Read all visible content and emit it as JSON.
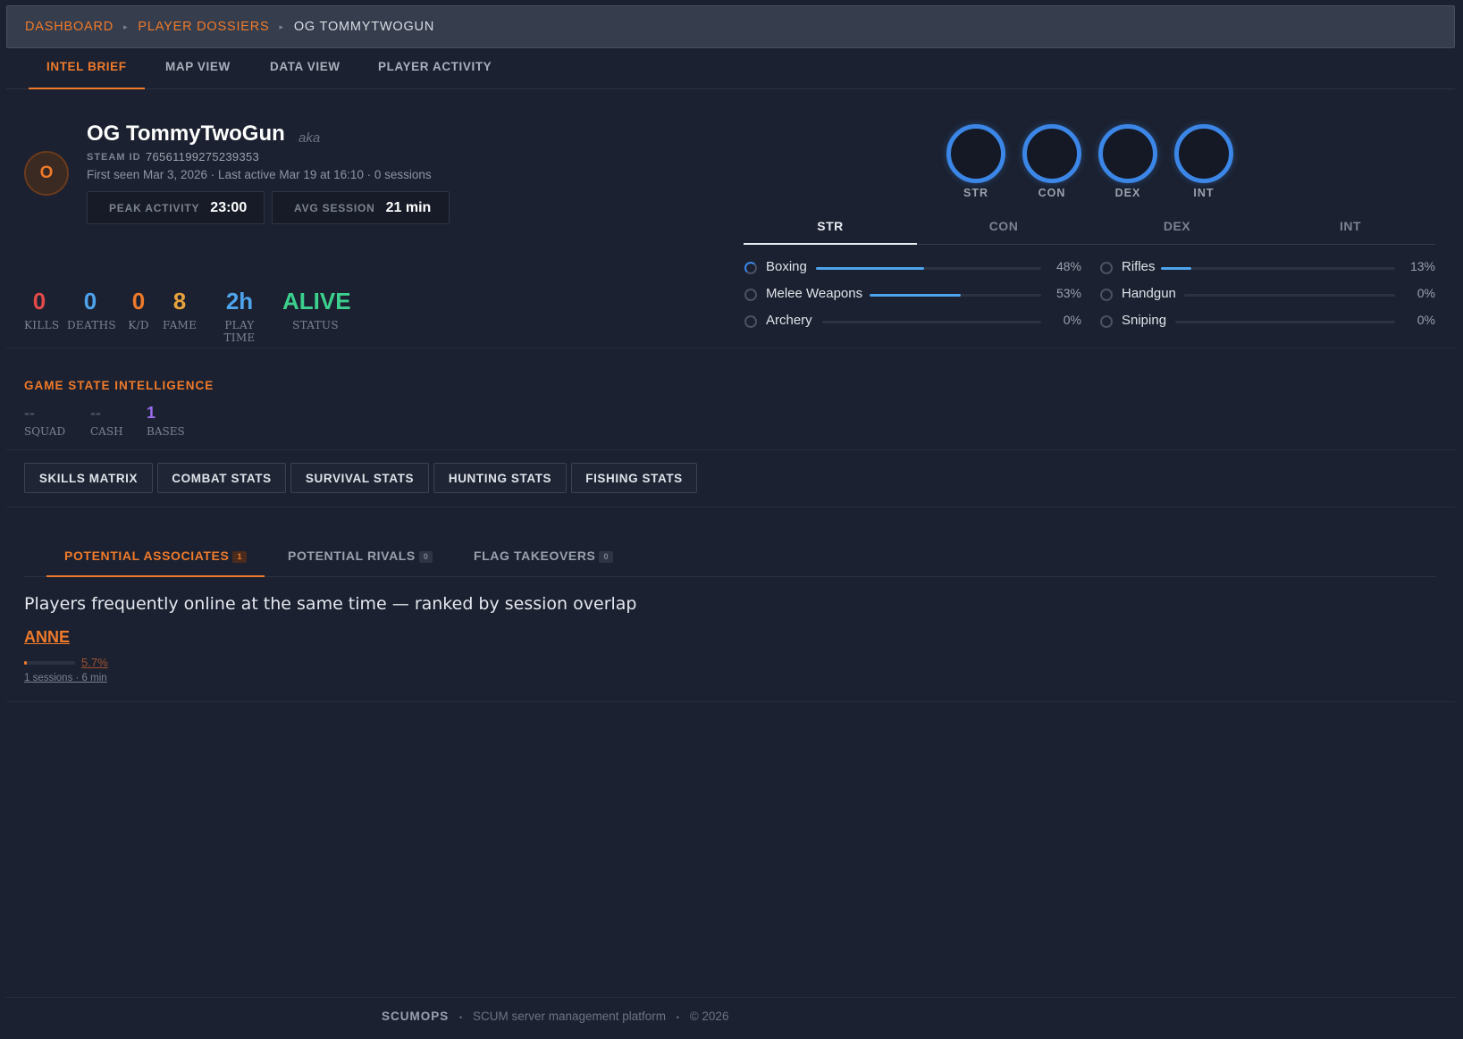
{
  "breadcrumb": {
    "items": [
      "DASHBOARD",
      "PLAYER DOSSIERS"
    ],
    "current": "OG TOMMYTWOGUN",
    "separator": "▸"
  },
  "tabs": [
    "INTEL BRIEF",
    "MAP VIEW",
    "DATA VIEW",
    "PLAYER ACTIVITY"
  ],
  "active_tab": "INTEL BRIEF",
  "player": {
    "avatar_letter": "O",
    "name": "OG TommyTwoGun",
    "aka": "aka",
    "steam_label": "STEAM ID",
    "steam_id": "76561199275239353",
    "seen": "First seen Mar 3, 2026 · Last active Mar 19 at 16:10 · 0 sessions",
    "peak_label": "PEAK ACTIVITY",
    "peak_value": "23:00",
    "avg_label": "AVG SESSION",
    "avg_value": "21 min"
  },
  "stats": [
    {
      "value": "0",
      "label": "KILLS",
      "color": "#e24a4a"
    },
    {
      "value": "0",
      "label": "DEATHS",
      "color": "#4ea4ec"
    },
    {
      "value": "0",
      "label": "K/D",
      "color": "#f07a2a"
    },
    {
      "value": "8",
      "label": "FAME",
      "color": "#e8a23c"
    },
    {
      "value": "2h",
      "label": "PLAY TIME",
      "color": "#4ea4ec"
    },
    {
      "value": "ALIVE",
      "label": "STATUS",
      "color": "#3ccf8e"
    }
  ],
  "attributes": [
    "STR",
    "CON",
    "DEX",
    "INT"
  ],
  "skill_tabs": [
    "STR",
    "CON",
    "DEX",
    "INT"
  ],
  "active_skill_tab": "STR",
  "skills_left": [
    {
      "name": "Boxing",
      "pct": "48%",
      "value": 0.48,
      "partial": true
    },
    {
      "name": "Melee Weapons",
      "pct": "53%",
      "value": 0.53,
      "partial": false
    },
    {
      "name": "Archery",
      "pct": "0%",
      "value": 0,
      "partial": false
    }
  ],
  "skills_right": [
    {
      "name": "Rifles",
      "pct": "13%",
      "value": 0.13,
      "partial": false
    },
    {
      "name": "Handgun",
      "pct": "0%",
      "value": 0,
      "partial": false
    },
    {
      "name": "Sniping",
      "pct": "0%",
      "value": 0,
      "partial": false
    }
  ],
  "game_state": {
    "title": "GAME STATE INTELLIGENCE",
    "items": [
      {
        "value": "--",
        "label": "SQUAD",
        "color": "#4a5162"
      },
      {
        "value": "--",
        "label": "CASH",
        "color": "#4a5162"
      },
      {
        "value": "1",
        "label": "BASES",
        "color": "#9b6cf0"
      }
    ]
  },
  "buttons": [
    "SKILLS MATRIX",
    "COMBAT STATS",
    "SURVIVAL STATS",
    "HUNTING STATS",
    "FISHING STATS"
  ],
  "assoc_tabs": [
    {
      "label": "POTENTIAL ASSOCIATES",
      "count": "1"
    },
    {
      "label": "POTENTIAL RIVALS",
      "count": "0"
    },
    {
      "label": "FLAG TAKEOVERS",
      "count": "0"
    }
  ],
  "associates": {
    "description": "Players frequently online at the same time — ranked by session overlap",
    "entries": [
      {
        "name": "ANNE",
        "overlap": "5.7%",
        "overlap_value": 0.057,
        "meta": "1 sessions · 6 min"
      }
    ]
  },
  "footer": {
    "brand": "SCUMOPS",
    "tagline": "SCUM server management platform",
    "copyright": "© 2026",
    "dot": "•"
  }
}
